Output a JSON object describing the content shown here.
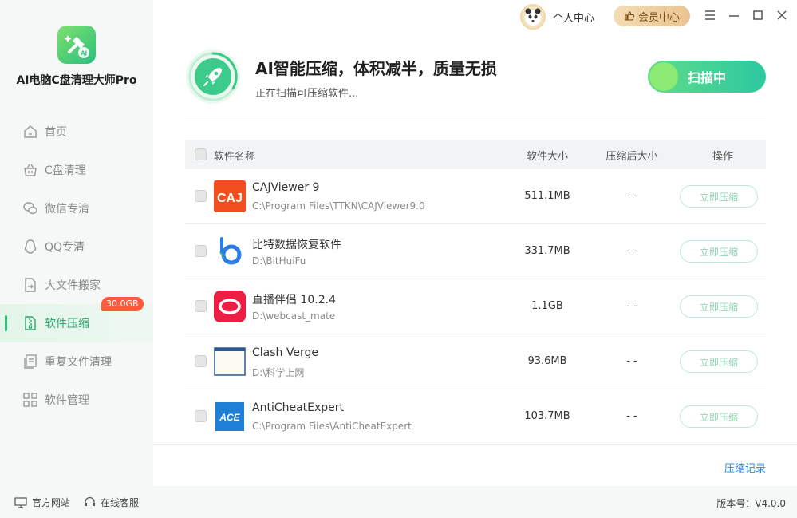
{
  "app": {
    "name": "AI电脑C盘清理大师Pro"
  },
  "nav": {
    "items": [
      {
        "label": "首页",
        "icon": "home-icon"
      },
      {
        "label": "C盘清理",
        "icon": "basket-icon"
      },
      {
        "label": "微信专清",
        "icon": "wechat-icon"
      },
      {
        "label": "QQ专清",
        "icon": "qq-icon"
      },
      {
        "label": "大文件搬家",
        "icon": "file-move-icon"
      },
      {
        "label": "软件压缩",
        "icon": "zip-icon",
        "badge": "30.0GB",
        "active": true
      },
      {
        "label": "重复文件清理",
        "icon": "duplicate-icon"
      },
      {
        "label": "软件管理",
        "icon": "apps-icon"
      }
    ]
  },
  "topbar": {
    "personal_center": "个人中心",
    "vip_center": "会员中心"
  },
  "hero": {
    "title": "AI智能压缩，体积减半，质量无损",
    "subtitle": "正在扫描可压缩软件...",
    "scan_button": "扫描中"
  },
  "table": {
    "headers": {
      "name": "软件名称",
      "size": "软件大小",
      "compressed": "压缩后大小",
      "action": "操作"
    },
    "rows": [
      {
        "name": "CAJViewer 9",
        "path": "C:\\Program Files\\TTKN\\CAJViewer9.0",
        "size": "511.1MB",
        "compressed": "- -",
        "action": "立即压缩",
        "icon": "cajviewer-icon"
      },
      {
        "name": "比特数据恢复软件",
        "path": "D:\\BitHuiFu",
        "size": "331.7MB",
        "compressed": "- -",
        "action": "立即压缩",
        "icon": "bit-recovery-icon"
      },
      {
        "name": "直播伴侣 10.2.4",
        "path": "D:\\webcast_mate",
        "size": "1.1GB",
        "compressed": "- -",
        "action": "立即压缩",
        "icon": "webcast-mate-icon"
      },
      {
        "name": "Clash Verge",
        "path": "D:\\科学上网",
        "size": "93.6MB",
        "compressed": "- -",
        "action": "立即压缩",
        "icon": "window-app-icon"
      },
      {
        "name": "AntiCheatExpert",
        "path": "C:\\Program Files\\AntiCheatExpert",
        "size": "103.7MB",
        "compressed": "- -",
        "action": "立即压缩",
        "icon": "ace-icon"
      }
    ]
  },
  "history_link": "压缩记录",
  "footer": {
    "website": "官方网站",
    "support": "在线客服",
    "version": "版本号：V4.0.0"
  },
  "colors": {
    "accent": "#2cc27c",
    "badge": "#ff5a3c",
    "link": "#2e86de",
    "vip": "#e9c48f"
  }
}
